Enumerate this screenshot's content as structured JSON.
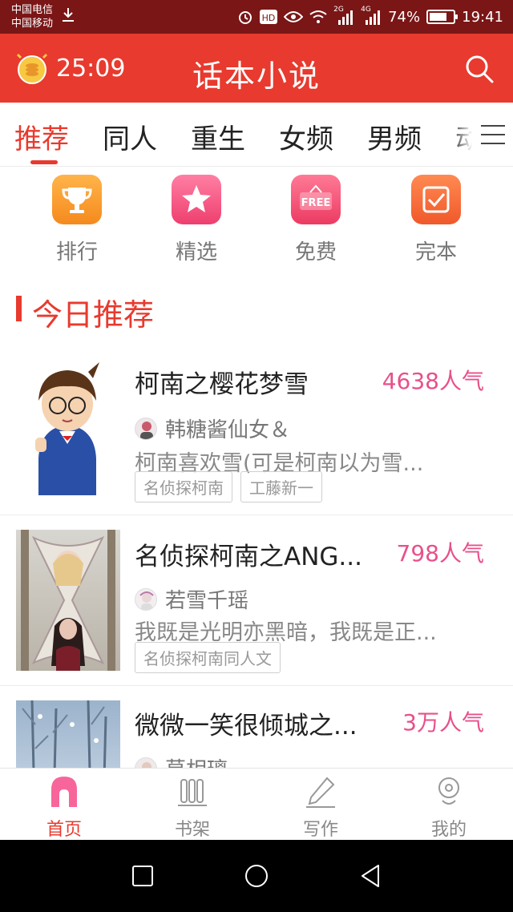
{
  "status_bar": {
    "carrier_1": "中国电信",
    "carrier_2": "中国移动",
    "net_2g": "2G",
    "net_4g": "4G",
    "battery": "74%",
    "battery_level": 0.74,
    "time": "19:41"
  },
  "header": {
    "timer": "25:09",
    "title": "话本小说"
  },
  "tabs": [
    {
      "label": "推荐"
    },
    {
      "label": "同人"
    },
    {
      "label": "重生"
    },
    {
      "label": "女频"
    },
    {
      "label": "男频"
    },
    {
      "label": "动"
    }
  ],
  "quick_entries": [
    {
      "label": "排行",
      "icon": "trophy-icon",
      "color": "#f59a2e"
    },
    {
      "label": "精选",
      "icon": "star-icon",
      "color": "#f04d7a"
    },
    {
      "label": "免费",
      "icon": "free-icon",
      "free_text": "FREE",
      "color": "#f0486e"
    },
    {
      "label": "完本",
      "icon": "check-icon",
      "color": "#f26a3a"
    }
  ],
  "section": {
    "title": "今日推荐"
  },
  "books": [
    {
      "title": "柯南之樱花梦雪",
      "popularity": "4638人气",
      "author": "韩糖酱仙女＆",
      "description": "柯南喜欢雪(可是柯南以为雪...",
      "tags": [
        "名侦探柯南",
        "工藤新一"
      ]
    },
    {
      "title": "名侦探柯南之ANG...",
      "popularity": "798人气",
      "author": "若雪千瑶",
      "description": "我既是光明亦黑暗，我既是正...",
      "tags": [
        "名侦探柯南同人文"
      ]
    },
    {
      "title": "微微一笑很倾城之...",
      "popularity": "3万人气",
      "author": "莫相璃"
    }
  ],
  "bottom_nav": [
    {
      "label": "首页"
    },
    {
      "label": "书架"
    },
    {
      "label": "写作"
    },
    {
      "label": "我的"
    }
  ],
  "colors": {
    "brand": "#e83a2e",
    "popularity": "#e8508a"
  }
}
